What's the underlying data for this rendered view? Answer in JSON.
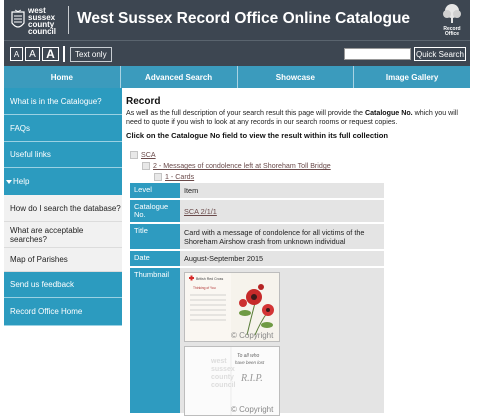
{
  "header": {
    "logo_lines": [
      "west",
      "sussex",
      "county",
      "council"
    ],
    "title": "West Sussex Record Office Online Catalogue",
    "ro_logo_lines": [
      "Record",
      "Office"
    ]
  },
  "accessbar": {
    "font_small": "A",
    "font_medium": "A",
    "font_large": "A",
    "text_only": "Text only",
    "search_value": "",
    "search_button": "Quick Search"
  },
  "nav": [
    "Home",
    "Advanced Search",
    "Showcase",
    "Image Gallery"
  ],
  "sidebar": {
    "items": [
      "What is in the Catalogue?",
      "FAQs",
      "Useful links",
      "Help",
      "How do I search the database?",
      "What are acceptable searches?",
      "Map of Parishes",
      "Send us feedback",
      "Record Office Home"
    ]
  },
  "record": {
    "title": "Record",
    "desc_before": "As well as the full description of your search result this page will provide the ",
    "desc_bold": "Catalogue No.",
    "desc_after": " which you will need to quote if you wish to look at any records in our search rooms or request copies.",
    "click_note": "Click on the Catalogue No field to view the result within its full collection"
  },
  "tree": [
    "SCA",
    "2 - Messages of condolence left at Shoreham Toll Bridge",
    "1 - Cards"
  ],
  "fields": {
    "level_label": "Level",
    "level_value": "Item",
    "catno_label": "Catalogue No.",
    "catno_value": "SCA 2/1/1",
    "title_label": "Title",
    "title_value": "Card with a message of condolence for all victims of the Shoreham Airshow crash from unknown individual",
    "date_label": "Date",
    "date_value": "August-September 2015",
    "thumb_label": "Thumbnail"
  },
  "thumbnails": {
    "card1_brand": "British Red Cross",
    "card1_heading": "Thinking of You",
    "card2_line1": "To all who",
    "card2_line2": "have been lost",
    "card2_rip": "R.I.P.",
    "watermark_lines": [
      "west",
      "sussex",
      "county",
      "council"
    ],
    "copyright": "© Copyright"
  },
  "colors": {
    "header_bg": "#3d4651",
    "nav_bg": "#3b9bbd",
    "sidebar_blue": "#2c9bbf",
    "label_blue": "#2e9bc0"
  }
}
